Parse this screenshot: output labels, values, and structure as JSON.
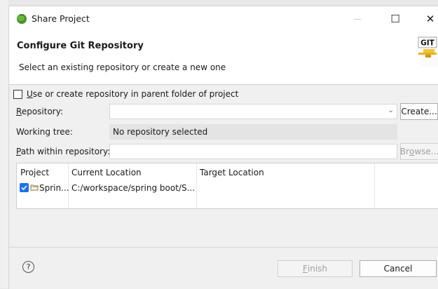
{
  "window": {
    "title": "Share Project",
    "controls": {
      "minimize": "—",
      "maximize": "☐",
      "close": "✕"
    }
  },
  "header": {
    "title": "Configure Git Repository",
    "description": "Select an existing repository or create a new one",
    "badge_text": "GIT"
  },
  "use_parent": {
    "label_first": "U",
    "label_rest": "se or create repository in parent folder of project",
    "checked": false
  },
  "repository": {
    "label_first": "R",
    "label_rest": "epository:",
    "value": "",
    "create_label": "Create..."
  },
  "working_tree": {
    "label": "Working tree:",
    "value": "No repository selected"
  },
  "path": {
    "label_first": "P",
    "label_rest": "ath within repository:",
    "value": "",
    "browse_first": "Br",
    "browse_u": "o",
    "browse_rest": "wse..."
  },
  "table": {
    "columns": [
      "Project",
      "Current Location",
      "Target Location"
    ],
    "rows": [
      {
        "project": "Sprin...",
        "current": "C:/workspace/spring boot/S...",
        "target": "",
        "checked": true
      }
    ]
  },
  "footer": {
    "help": "?",
    "finish_first": "F",
    "finish_rest": "inish",
    "cancel": "Cancel"
  },
  "colors": {
    "accent": "#1a73e8",
    "window_bg": "#f0f0f0",
    "header_bg": "#ffffff"
  }
}
